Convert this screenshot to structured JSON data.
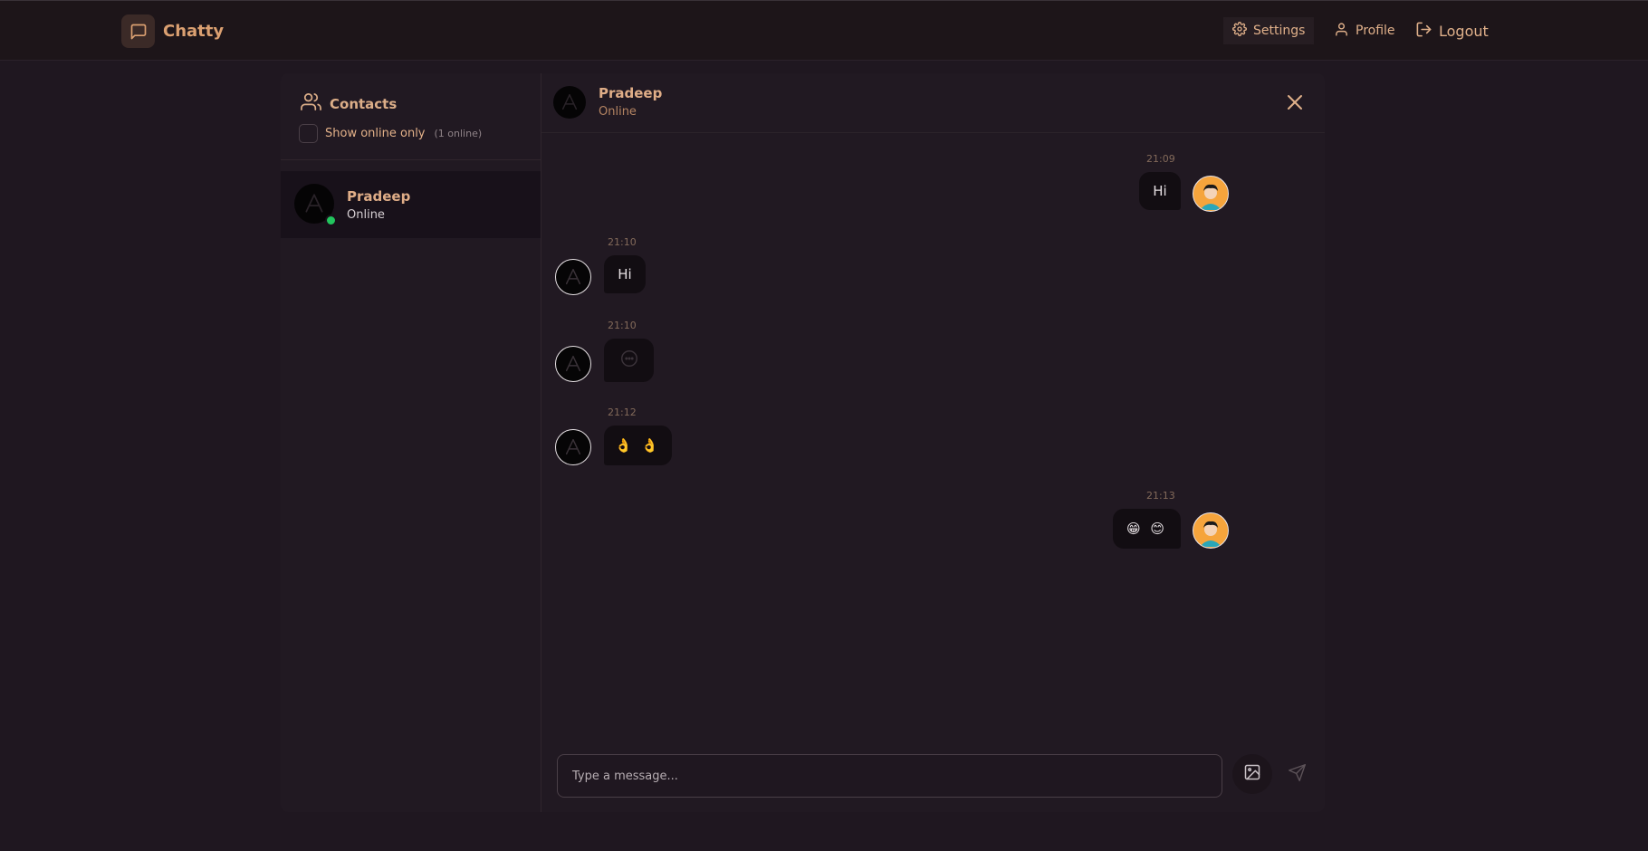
{
  "app": {
    "name": "Chatty",
    "accent": "#dba071"
  },
  "nav": {
    "settings": "Settings",
    "profile": "Profile",
    "logout": "Logout"
  },
  "sidebar": {
    "title": "Contacts",
    "filter_label": "Show online only",
    "filter_count": "(1 online)",
    "contacts": [
      {
        "name": "Pradeep",
        "status": "Online",
        "online": true
      }
    ]
  },
  "chat": {
    "contact_name": "Pradeep",
    "contact_status": "Online",
    "messages": [
      {
        "from": "me",
        "time": "21:09",
        "text": "Hi"
      },
      {
        "from": "them",
        "time": "21:10",
        "text": "Hi"
      },
      {
        "from": "them",
        "time": "21:10",
        "text": "",
        "content_icon": "chat-bubble-icon"
      },
      {
        "from": "them",
        "time": "21:12",
        "text": "👌 👌"
      },
      {
        "from": "me",
        "time": "21:13",
        "text": "😁 😊"
      }
    ],
    "composer_placeholder": "Type a message..."
  },
  "icons": {
    "brand": "message-square-icon",
    "settings": "gear-icon",
    "profile": "user-icon",
    "logout": "logout-icon",
    "contacts": "users-icon",
    "close": "close-icon",
    "image": "image-icon",
    "send": "send-icon"
  }
}
